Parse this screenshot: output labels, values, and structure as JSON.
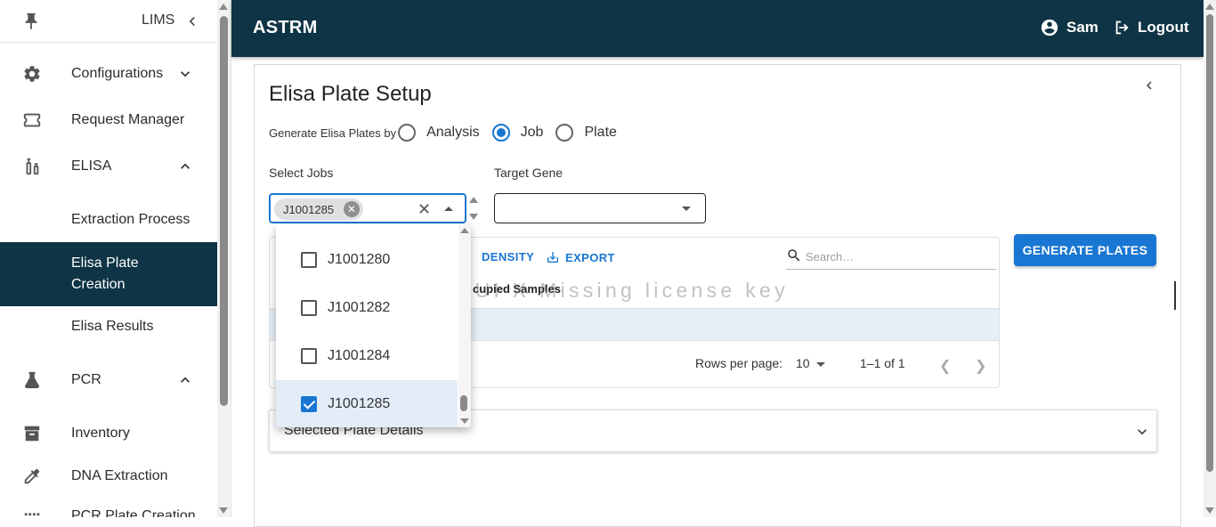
{
  "sidebar": {
    "app_label": "LIMS",
    "items": [
      {
        "label": "Configurations",
        "icon": "gear-icon"
      },
      {
        "label": "Request Manager",
        "icon": "ticket-icon"
      },
      {
        "label": "ELISA",
        "icon": "syringe-icon"
      },
      {
        "label": "Extraction Process"
      },
      {
        "label": "Elisa Plate\nCreation"
      },
      {
        "label": "Elisa Results"
      },
      {
        "label": "PCR",
        "icon": "flask-icon"
      },
      {
        "label": "Inventory",
        "icon": "archive-icon"
      },
      {
        "label": "DNA Extraction",
        "icon": "pipette-icon"
      },
      {
        "label": "PCR Plate Creation",
        "icon": "grid-icon"
      }
    ]
  },
  "header": {
    "title": "ASTRM",
    "user": "Sam",
    "logout": "Logout"
  },
  "page": {
    "title": "Elisa Plate Setup",
    "generate_by_label": "Generate Elisa Plates by",
    "radio_options": [
      "Analysis",
      "Job",
      "Plate"
    ],
    "selected_option": "Job",
    "select_jobs_label": "Select Jobs",
    "selected_chip": "J1001285",
    "target_gene_label": "Target Gene",
    "target_gene_value": "",
    "generate_button": "GENERATE PLATES"
  },
  "grid": {
    "toolbar": {
      "density": "DENSITY",
      "export": "EXPORT"
    },
    "search_placeholder": "Search…",
    "column_header": "cupied Samples",
    "rows_per_page_label": "Rows per page:",
    "rows_per_page": "10",
    "range": "1–1 of 1",
    "watermark": "MUI X Missing license key"
  },
  "accordion": {
    "title": "Selected Plate Details"
  },
  "jobs_dropdown": {
    "options": [
      {
        "label": "J1001280",
        "checked": false
      },
      {
        "label": "J1001282",
        "checked": false
      },
      {
        "label": "J1001284",
        "checked": false
      },
      {
        "label": "J1001285",
        "checked": true
      }
    ]
  },
  "colors": {
    "header_bg": "#0e3445",
    "active_nav_bg": "#0e3445",
    "primary": "#1976d2"
  }
}
